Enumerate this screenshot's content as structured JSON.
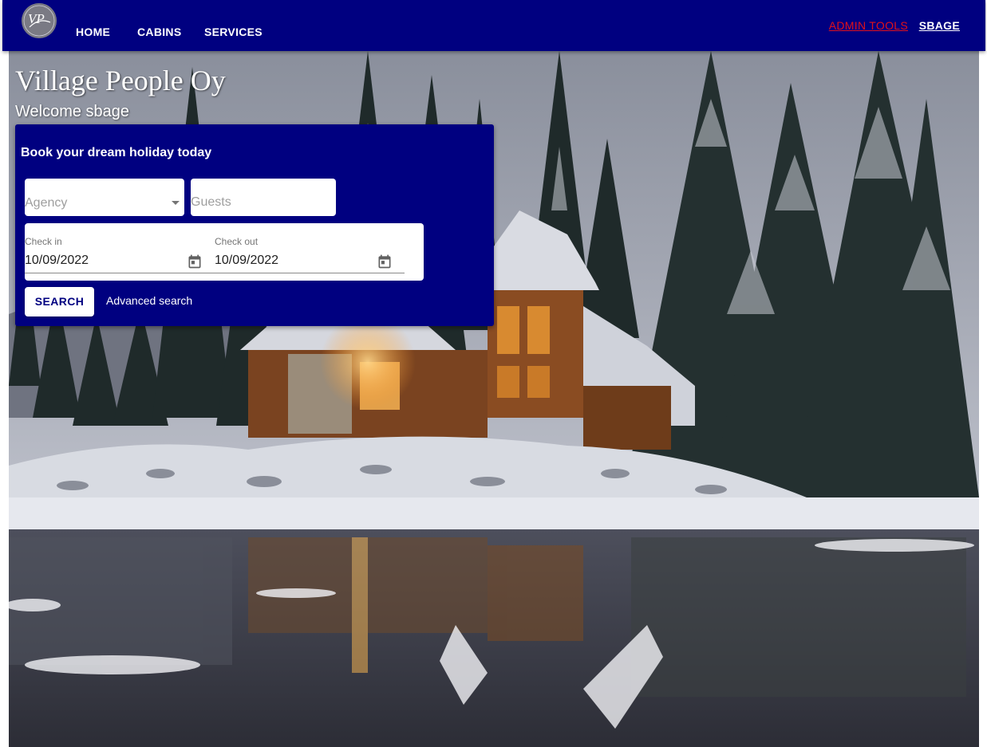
{
  "nav": {
    "logo_text": "VP",
    "home": "HOME",
    "cabins": "CABINS",
    "services": "SERVICES",
    "admin_tools": "ADMIN TOOLS",
    "user": "SBAGE"
  },
  "hero": {
    "title": "Village People Oy",
    "welcome": "Welcome sbage"
  },
  "booking": {
    "heading": "Book your dream holiday today",
    "agency_placeholder": "Agency",
    "guests_placeholder": "Guests",
    "check_in_label": "Check in",
    "check_in_value": "10/09/2022",
    "check_out_label": "Check out",
    "check_out_value": "10/09/2022",
    "search_label": "SEARCH",
    "advanced_label": "Advanced search"
  },
  "colors": {
    "appbar": "#000080",
    "admin_link": "#e0101a",
    "card": "#000080"
  },
  "icons": [
    "logo-icon",
    "dropdown-arrow-icon",
    "calendar-icon"
  ]
}
